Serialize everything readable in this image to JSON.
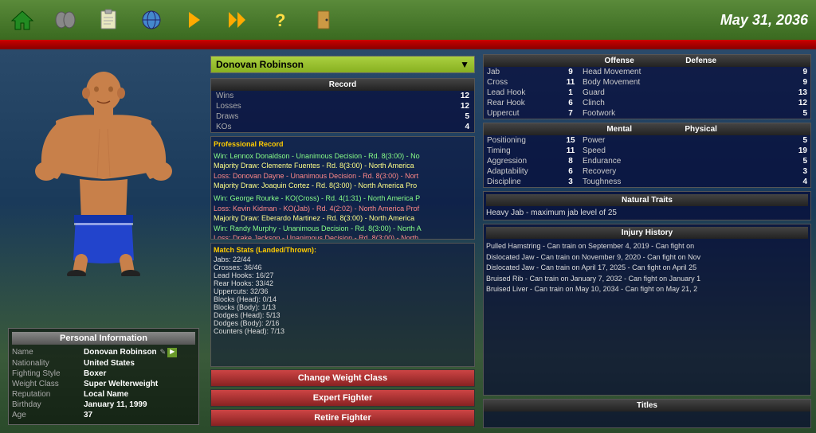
{
  "toolbar": {
    "date": "May 31, 2036",
    "icons": [
      {
        "name": "home-icon",
        "label": "Home"
      },
      {
        "name": "gloves-icon",
        "label": "Gloves"
      },
      {
        "name": "clipboard-icon",
        "label": "Clipboard"
      },
      {
        "name": "globe-icon",
        "label": "Globe"
      },
      {
        "name": "arrow-icon",
        "label": "Next"
      },
      {
        "name": "fast-forward-icon",
        "label": "Fast Forward"
      },
      {
        "name": "question-icon",
        "label": "Help"
      },
      {
        "name": "door-icon",
        "label": "Exit"
      }
    ]
  },
  "fighter": {
    "name": "Donovan Robinson",
    "dropdown_arrow": "▼",
    "record": {
      "title": "Record",
      "wins_label": "Wins",
      "wins_value": "12",
      "losses_label": "Losses",
      "losses_value": "12",
      "draws_label": "Draws",
      "draws_value": "5",
      "kos_label": "KOs",
      "kos_value": "4"
    },
    "pro_record_title": "Professional Record",
    "pro_record_lines": [
      "Win: Lennox Donaldson - Unanimous Decision - Rd. 8(3:00) - No",
      "Majority Draw: Clemente Fuentes - Rd. 8(3:00) - North America",
      "Loss: Donovan Dayne - Unanimous Decision - Rd. 8(3:00) - Nort",
      "Majority Draw: Joaquin Cortez - Rd. 8(3:00) - North America Pro",
      "",
      "Win: George Rourke - KO(Cross) - Rd. 4(1:31) - North America P",
      "Loss: Kevin Kidman - KO(Jab) - Rd. 4(2:02) - North America Prof",
      "Majority Draw: Eberardo Martinez - Rd. 8(3:00) - North America",
      "Win: Randy Murphy - Unanimous Decision - Rd. 8(3:00) - North A",
      "Loss: Drake Jackson - Unanimous Decision - Rd. 8(3:00) - North"
    ],
    "match_stats_title": "Match Stats (Landed/Thrown):",
    "match_stats": [
      "Jabs: 22/44",
      "Crosses: 36/46",
      "Lead Hooks: 16/27",
      "Rear Hooks: 33/42",
      "Uppercuts: 32/36",
      "Blocks (Head): 0/14",
      "Blocks (Body): 1/13",
      "Dodges (Head): 5/13",
      "Dodges (Body): 2/16",
      "Counters (Head): 7/13"
    ],
    "buttons": {
      "change_weight": "Change Weight Class",
      "expert": "Expert Fighter",
      "retire": "Retire Fighter"
    }
  },
  "personal_info": {
    "title": "Personal Information",
    "name_label": "Name",
    "name_value": "Donovan Robinson",
    "nationality_label": "Nationality",
    "nationality_value": "United States",
    "fighting_style_label": "Fighting Style",
    "fighting_style_value": "Boxer",
    "weight_class_label": "Weight Class",
    "weight_class_value": "Super Welterweight",
    "reputation_label": "Reputation",
    "reputation_value": "Local Name",
    "birthday_label": "Birthday",
    "birthday_value": "January 11, 1999",
    "age_label": "Age",
    "age_value": "37"
  },
  "stats": {
    "offense_header": "Offense",
    "defense_header": "Defense",
    "offense_stats": [
      {
        "label": "Jab",
        "value": "9",
        "d_label": "Head Movement",
        "d_value": "9"
      },
      {
        "label": "Cross",
        "value": "11",
        "d_label": "Body Movement",
        "d_value": "9"
      },
      {
        "label": "Lead Hook",
        "value": "1",
        "d_label": "Guard",
        "d_value": "13"
      },
      {
        "label": "Rear Hook",
        "value": "6",
        "d_label": "Clinch",
        "d_value": "12"
      },
      {
        "label": "Uppercut",
        "value": "7",
        "d_label": "Footwork",
        "d_value": "5"
      }
    ],
    "mental_header": "Mental",
    "physical_header": "Physical",
    "mental_stats": [
      {
        "label": "Positioning",
        "value": "15",
        "p_label": "Power",
        "p_value": "5"
      },
      {
        "label": "Timing",
        "value": "11",
        "p_label": "Speed",
        "p_value": "19"
      },
      {
        "label": "Aggression",
        "value": "8",
        "p_label": "Endurance",
        "p_value": "5"
      },
      {
        "label": "Adaptability",
        "value": "6",
        "p_label": "Recovery",
        "p_value": "3"
      },
      {
        "label": "Discipline",
        "value": "3",
        "p_label": "Toughness",
        "p_value": "4"
      }
    ],
    "natural_traits_title": "Natural Traits",
    "natural_traits_text": "Heavy Jab - maximum jab level of 25",
    "injury_title": "Injury History",
    "injury_lines": [
      "Pulled Hamstring - Can train on September 4, 2019 - Can fight on",
      "Dislocated Jaw - Can train on November 9, 2020 - Can fight on Nov",
      "Dislocated Jaw - Can train on April 17, 2025 - Can fight on April 25",
      "Bruised Rib - Can train on January 7, 2032 - Can fight on January 1",
      "Bruised Liver - Can train on May 10, 2034 - Can fight on May 21, 2"
    ],
    "titles_title": "Titles"
  }
}
